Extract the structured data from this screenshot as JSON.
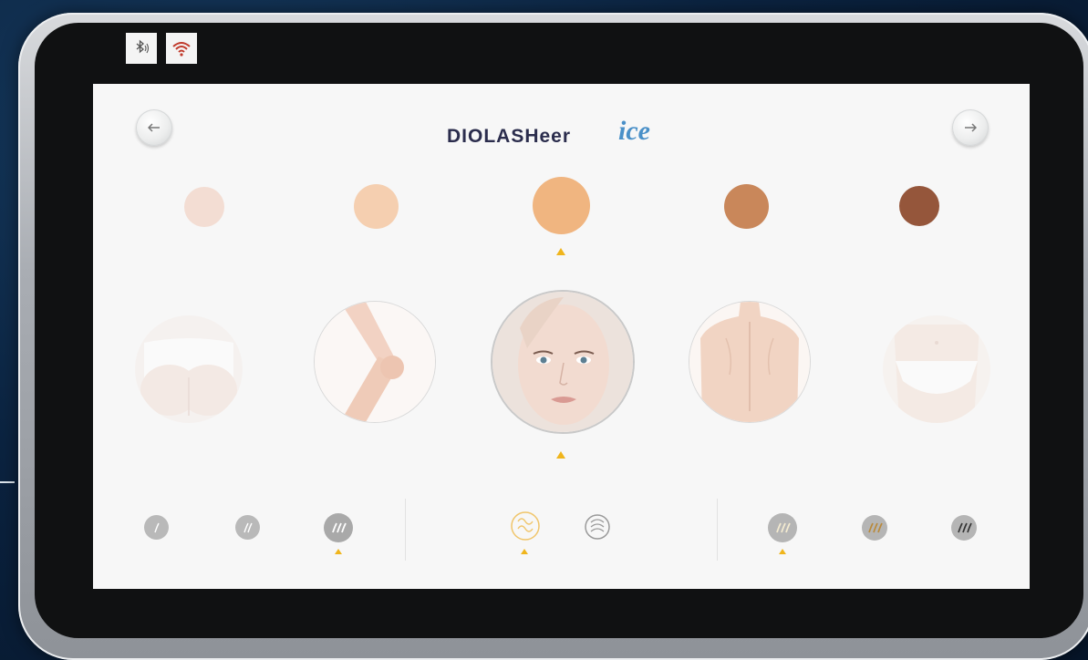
{
  "status_bar": {
    "icons": [
      "bluetooth-icon",
      "wifi-icon"
    ]
  },
  "header": {
    "logo_main": "DIOLASHeer",
    "logo_accent": "ice",
    "back_icon": "arrow-left-icon",
    "forward_icon": "arrow-right-icon"
  },
  "colors": {
    "marker": "#f0b51c",
    "logo_main": "#2b2d4d",
    "logo_accent": "#4a90c8",
    "skin_tones": [
      "#f3ddd3",
      "#f5cfb0",
      "#f0b580",
      "#c9875a",
      "#95563b"
    ]
  },
  "skin_tones": {
    "count": 5,
    "selected_index": 2
  },
  "body_zones": {
    "items": [
      "buttocks",
      "arm",
      "face",
      "back",
      "bikini"
    ],
    "selected_index": 2
  },
  "hair_thickness": {
    "items": [
      "fine-hair",
      "medium-hair",
      "thick-hair"
    ],
    "selected_index": 2
  },
  "hair_type": {
    "items": [
      "curly-hair",
      "straight-hair"
    ],
    "selected_index": 0
  },
  "hair_color": {
    "items": [
      "light-hair",
      "medium-hair-color",
      "dark-hair"
    ],
    "selected_index": 0
  }
}
